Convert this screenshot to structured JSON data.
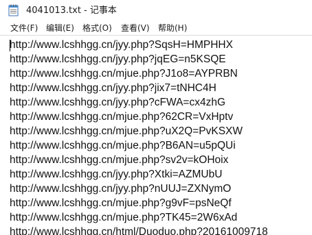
{
  "window": {
    "title": "4041013.txt - 记事本",
    "icon": "notepad-icon"
  },
  "menu": [
    {
      "label": "文件(F)"
    },
    {
      "label": "编辑(E)"
    },
    {
      "label": "格式(O)"
    },
    {
      "label": "查看(V)"
    },
    {
      "label": "帮助(H)"
    }
  ],
  "editor": {
    "lines": [
      "http://www.lcshhgg.cn/jyy.php?SqsH=HMPHHX",
      "http://www.lcshhgg.cn/jyy.php?jqEG=n5KSQE",
      "http://www.lcshhgg.cn/mjue.php?J1o8=AYPRBN",
      "http://www.lcshhgg.cn/jyy.php?jix7=tNHC4H",
      "http://www.lcshhgg.cn/jyy.php?cFWA=cx4zhG",
      "http://www.lcshhgg.cn/mjue.php?62CR=VxHptv",
      "http://www.lcshhgg.cn/mjue.php?uX2Q=PvKSXW",
      "http://www.lcshhgg.cn/mjue.php?B6AN=u5pQUi",
      "http://www.lcshhgg.cn/mjue.php?sv2v=kOHoix",
      "http://www.lcshhgg.cn/jyy.php?Xtki=AZMUbU",
      "http://www.lcshhgg.cn/jyy.php?nUUJ=ZXNymO",
      "http://www.lcshhgg.cn/mjue.php?g9vF=psNeQf",
      "http://www.lcshhgg.cn/mjue.php?TK45=2W6xAd",
      "http://www.lcshhgg.cn/html/Duoduo.php?20161009718"
    ]
  }
}
